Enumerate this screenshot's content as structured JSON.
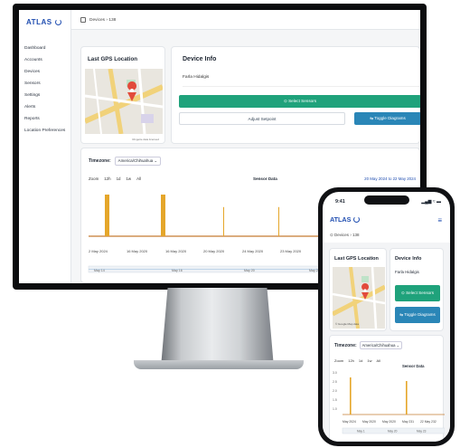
{
  "colors": {
    "brand": "#1f4db0",
    "green": "#1fa27b",
    "blue": "#2a86b7",
    "bar": "#e5a62a",
    "baseline": "#c57b32"
  },
  "desktop": {
    "logo": "ATLAS",
    "nav": [
      "Dashboard",
      "Accounts",
      "Devices",
      "Sensors",
      "Settings",
      "Alerts",
      "Reports",
      "Location Preferences"
    ],
    "breadcrumb": "Devices  ›  138",
    "gps": {
      "title": "Last GPS Location",
      "caption": "Ringette data licensed"
    },
    "device": {
      "title": "Device Info",
      "name": "Farla Hidalgis",
      "select_sensors": "⊙  Select Sensors",
      "adjust_setpoint": "Adjust Setpoint",
      "toggle_diagrams": "⇆  Toggle Diagrams"
    },
    "chart": {
      "timezone_label": "Timezone:",
      "timezone_value": "America/Chihuahua ⌄",
      "zoom": [
        "Zoom",
        "12h",
        "1d",
        "1w",
        "All"
      ],
      "title": "Sensor Data",
      "range": "20 May 2024 to 22 May 2024",
      "x_labels": [
        "2 May 2024",
        "16 May 2020",
        "16 May 2020",
        "20 May 2020",
        "24 May 2020",
        "23 May 2020",
        "23 May 2020"
      ],
      "nav_labels": [
        "May 14",
        "May 16",
        "May 20",
        "May 22"
      ]
    }
  },
  "phone": {
    "time": "9:41",
    "status": "▂▄▆  ≈  ▬",
    "logo": "ATLAS",
    "breadcrumb": "⊙  Devices  ›  138",
    "gps": {
      "title": "Last GPS Location",
      "caption": "© Google Map data"
    },
    "device": {
      "title": "Device Info",
      "name": "Farla Hidalgis",
      "select_sensors": "⊙ Select Sensors",
      "toggle_diagrams": "⇆ Toggle Diagrams"
    },
    "chart": {
      "timezone_label": "Timezone:",
      "timezone_value": "America/Chihuahua ⌄",
      "zoom": [
        "Zoom",
        "12h",
        "1d",
        "1w",
        "All"
      ],
      "title": "Sensor Data",
      "y_labels": [
        "3.0",
        "2.5",
        "2.0",
        "1.5",
        "1.0"
      ],
      "x_labels": [
        "May 2024",
        "May 2020",
        "May 2020",
        "May 231",
        "22 May 232"
      ],
      "nav_labels": [
        "May 1",
        "May 20",
        "May 23"
      ]
    }
  },
  "chart_data": [
    {
      "type": "bar",
      "title": "Sensor Data",
      "series": [
        {
          "values": [
            1,
            1,
            0.7,
            0.7,
            0.7
          ]
        }
      ],
      "x": [
        "2 May 2024",
        "16 May 2020",
        "20 May 2020",
        "24 May 2020",
        "23 May 2020"
      ]
    },
    {
      "type": "bar",
      "title": "Sensor Data",
      "series": [
        {
          "values": [
            2.8,
            2.6
          ]
        }
      ],
      "x": [
        "May 2020",
        "May 231"
      ]
    }
  ]
}
